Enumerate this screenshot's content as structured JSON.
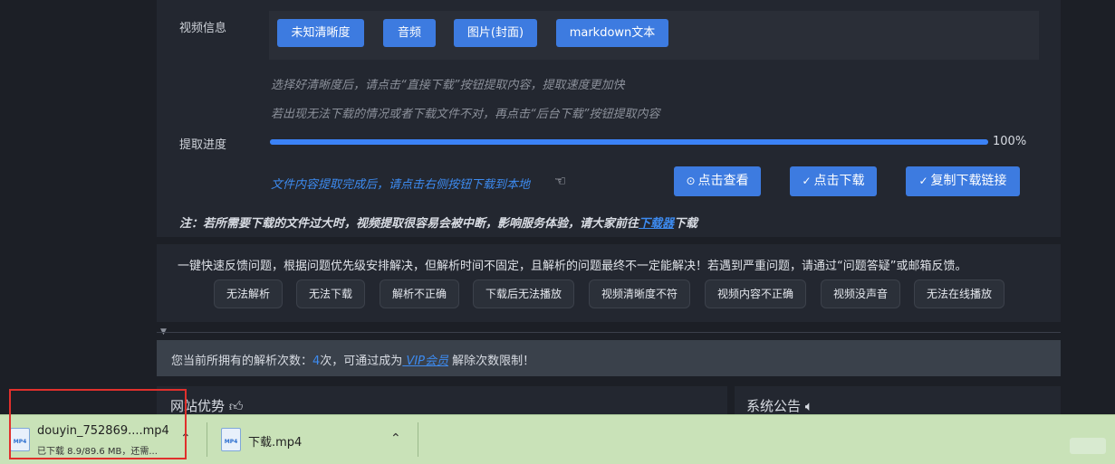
{
  "video_info": {
    "label": "视频信息",
    "chips": [
      "未知清晰度",
      "音频",
      "图片(封面)",
      "markdown文本"
    ],
    "hint1": "选择好清晰度后，请点击“直接下载”按钮提取内容，提取速度更加快",
    "hint2": "若出现无法下载的情况或者下载文件不对，再点击“后台下载”按钮提取内容"
  },
  "progress": {
    "label": "提取进度",
    "value_percent": 100,
    "text": "100%"
  },
  "done_message": "文件内容提取完成后，请点击右侧按钮下载到本地",
  "actions": {
    "view": "点击查看",
    "download": "点击下载",
    "copy_link": "复制下载链接"
  },
  "note": {
    "prefix": "注：若所需要下载的文件过大时，视频提取很容易会被中断，影响服务体验，请大家前往",
    "link": "下载器",
    "suffix": "下载"
  },
  "feedback": {
    "text": "一键快速反馈问题，根据问题优先级安排解决，但解析时间不固定，且解析的问题最终不一定能解决！若遇到严重问题，请通过“问题答疑”或邮箱反馈。",
    "buttons": [
      "无法解析",
      "无法下载",
      "解析不正确",
      "下载后无法播放",
      "视频清晰度不符",
      "视频内容不正确",
      "视频没声音",
      "无法在线播放"
    ]
  },
  "vip": {
    "prefix": "您当前所拥有的解析次数：",
    "count": "4",
    "mid": "次，可通过成为",
    "link": " VIP会员",
    "suffix": " 解除次数限制！"
  },
  "sections": {
    "advantages": "网站优势",
    "announcement": "系统公告"
  },
  "downloads": [
    {
      "name": "douyin_752869....mp4",
      "status": "已下载 8.9/89.6 MB，还需...",
      "icon_label": "MP4"
    },
    {
      "name": "下载.mp4",
      "status": "",
      "icon_label": "MP4"
    }
  ],
  "colors": {
    "accent": "#3d7be0",
    "link": "#3d8bf0",
    "bg": "#1c1f26",
    "download_bar": "#c9e2b8",
    "highlight": "#e0302c"
  }
}
